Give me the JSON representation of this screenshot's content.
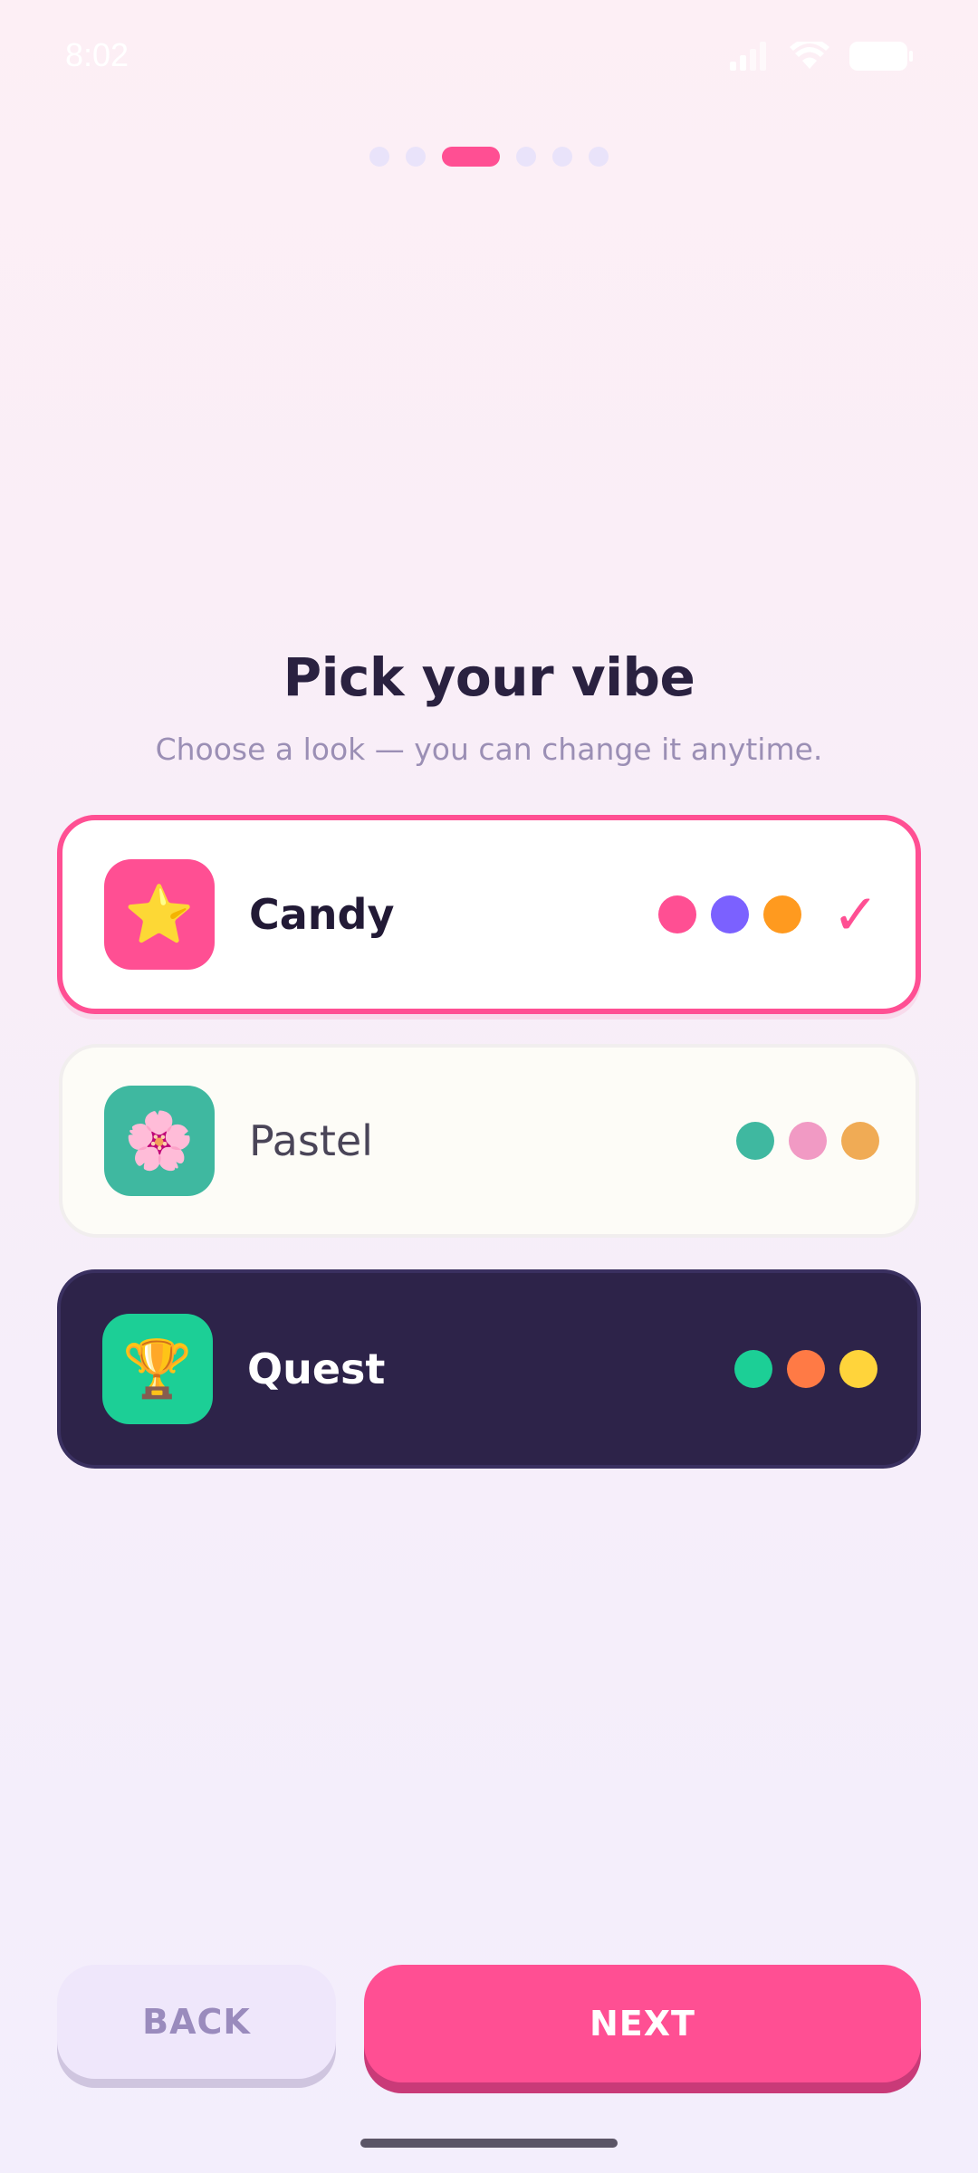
{
  "status_bar": {
    "time": "8:02"
  },
  "progress": {
    "total_steps": 6,
    "current_step": 3
  },
  "header": {
    "title": "Pick your vibe",
    "subtitle": "Choose a look — you can change it anytime."
  },
  "themes": [
    {
      "label": "Candy",
      "icon": "star-icon",
      "icon_glyph": "⭐",
      "selected": true,
      "colors": [
        "#ff4f93",
        "#7b61ff",
        "#ff9a1f"
      ]
    },
    {
      "label": "Pastel",
      "icon": "cherry-blossom-icon",
      "icon_glyph": "🌸",
      "selected": false,
      "colors": [
        "#3fb8a0",
        "#f19ac4",
        "#f0ab55"
      ]
    },
    {
      "label": "Quest",
      "icon": "trophy-icon",
      "icon_glyph": "🏆",
      "selected": false,
      "colors": [
        "#1ccf96",
        "#ff7a45",
        "#ffd43b"
      ]
    }
  ],
  "check_glyph": "✓",
  "footer": {
    "back_label": "BACK",
    "next_label": "NEXT"
  },
  "colors": {
    "accent": "#ff4f93",
    "dark_card": "#2d2349",
    "title": "#2a2140",
    "subtitle": "#9b8fb5"
  }
}
